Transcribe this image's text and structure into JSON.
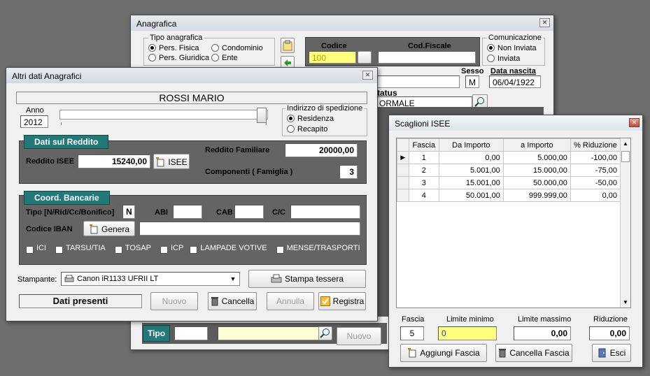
{
  "anagrafica": {
    "title": "Anagrafica",
    "tipo_title": "Tipo anagrafica",
    "tipo_opts": [
      "Pers. Fisica",
      "Condominio",
      "Pers. Giuridica",
      "Ente"
    ],
    "codice_label": "Codice",
    "codice_value": "100",
    "codfiscale_label": "Cod.Fiscale",
    "com_title": "Comunicazione",
    "com_opts": [
      "Non Inviata",
      "Inviata"
    ],
    "sesso_label": "Sesso",
    "sesso_value": "M",
    "nascita_label": "Data nascita",
    "nascita_value": "06/04/1922",
    "status_label": "tatus",
    "status_value": "ORMALE",
    "tipo_label": "Tipo",
    "nuovo": "Nuovo"
  },
  "altri": {
    "title": "Altri dati Anagrafici",
    "name": "ROSSI MARIO",
    "anno_label": "Anno",
    "anno_value": "2012",
    "indirizzo_title": "Indirizzo di spedizione",
    "indirizzo_opts": [
      "Residenza",
      "Recapito"
    ],
    "reddito_title": "Dati sul Reddito",
    "reddito_isee_label": "Reddito ISEE",
    "reddito_isee_value": "15240,00",
    "isee_btn": "ISEE",
    "reddito_fam_label": "Reddito Familiare",
    "reddito_fam_value": "20000,00",
    "componenti_label": "Componenti ( Famiglia )",
    "componenti_value": "3",
    "coord_title": "Coord. Bancarie",
    "tipo_label": "Tipo [N/Rid/Cc/Bonifico]",
    "tipo_value": "N",
    "abi_label": "ABI",
    "cab_label": "CAB",
    "cc_label": "C/C",
    "iban_label": "Codice IBAN",
    "genera": "Genera",
    "services": [
      "ICI",
      "TARSU/TIA",
      "TOSAP",
      "ICP",
      "LAMPADE VOTIVE",
      "MENSE/TRASPORTI"
    ],
    "stampante_label": "Stampante:",
    "stampante_value": "Canon iR1133 UFRII LT",
    "stampa_btn": "Stampa tessera",
    "dati_presenti": "Dati presenti",
    "nuovo": "Nuovo",
    "cancella": "Cancella",
    "annulla": "Annulla",
    "registra": "Registra"
  },
  "isee": {
    "title": "Scaglioni ISEE",
    "headers": [
      "Fascia",
      "Da Importo",
      "a Importo",
      "% Riduzione"
    ],
    "rows": [
      [
        "1",
        "0,00",
        "5.000,00",
        "-100,00"
      ],
      [
        "2",
        "5.001,00",
        "15.000,00",
        "-75,00"
      ],
      [
        "3",
        "15.001,00",
        "50.000,00",
        "-50,00"
      ],
      [
        "4",
        "50.001,00",
        "999.999,00",
        "0,00"
      ]
    ],
    "fascia_label": "Fascia",
    "fascia_value": "5",
    "min_label": "Limite minimo",
    "min_value": "0",
    "max_label": "Limite massimo",
    "max_value": "0,00",
    "rid_label": "Riduzione",
    "rid_value": "0,00",
    "aggiungi": "Aggiungi Fascia",
    "cancella": "Cancella Fascia",
    "esci": "Esci"
  },
  "colors": {
    "teal": "#237878",
    "yellow": "#ffff80",
    "dark": "#646464"
  }
}
